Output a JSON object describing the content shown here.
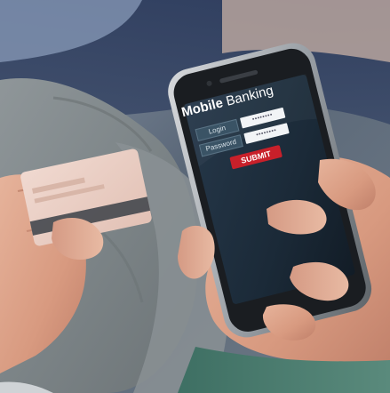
{
  "phone_screen": {
    "title_bold": "Mobile",
    "title_regular": "Banking",
    "login_label": "Login",
    "password_label": "Password",
    "login_value": "••••••••",
    "password_value": "••••••••",
    "submit_label": "SUBMIT"
  },
  "colors": {
    "screen": "#1b2a38",
    "submit": "#c8202a",
    "label_box": "#3a5365",
    "field": "#f2f4f6"
  }
}
